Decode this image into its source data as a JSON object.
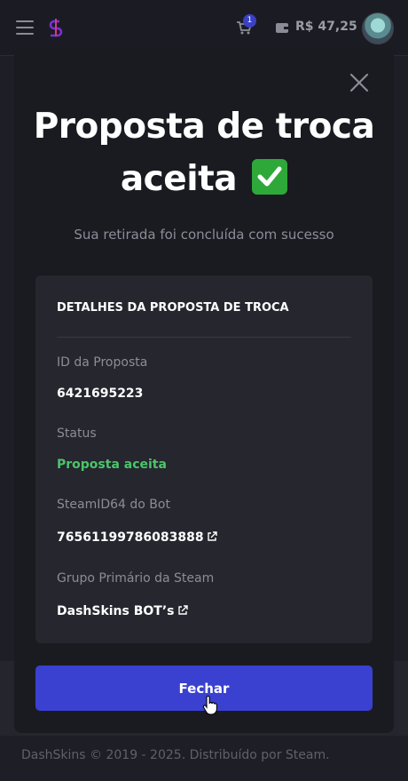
{
  "navbar": {
    "cart_count": "1",
    "balance": "R$ 47,25",
    "icons": [
      "hamburger-icon",
      "logo-icon",
      "cart-icon",
      "wallet-icon",
      "avatar"
    ]
  },
  "modal": {
    "title_line1": "Proposta de troca",
    "title_line2": "aceita",
    "title_emoji": "check-mark-icon",
    "subtitle": "Sua retirada foi concluída com sucesso",
    "details": {
      "heading": "DETALHES DA PROPOSTA DE TROCA",
      "fields": [
        {
          "label": "ID da Proposta",
          "value": "6421695223"
        },
        {
          "label": "Status",
          "value": "Proposta aceita"
        },
        {
          "label": "SteamID64 do Bot",
          "value": "76561199786083888"
        },
        {
          "label": "Grupo Primário da Steam",
          "value": "DashSkins BOT’s"
        }
      ]
    },
    "close_button_label": "Fechar"
  },
  "footer": {
    "text": "DashSkins © 2019 - 2025. Distribuído por Steam."
  },
  "colors": {
    "accent": "#3a41d0",
    "status_green": "#4cc46a",
    "background": "#1a1b21"
  }
}
